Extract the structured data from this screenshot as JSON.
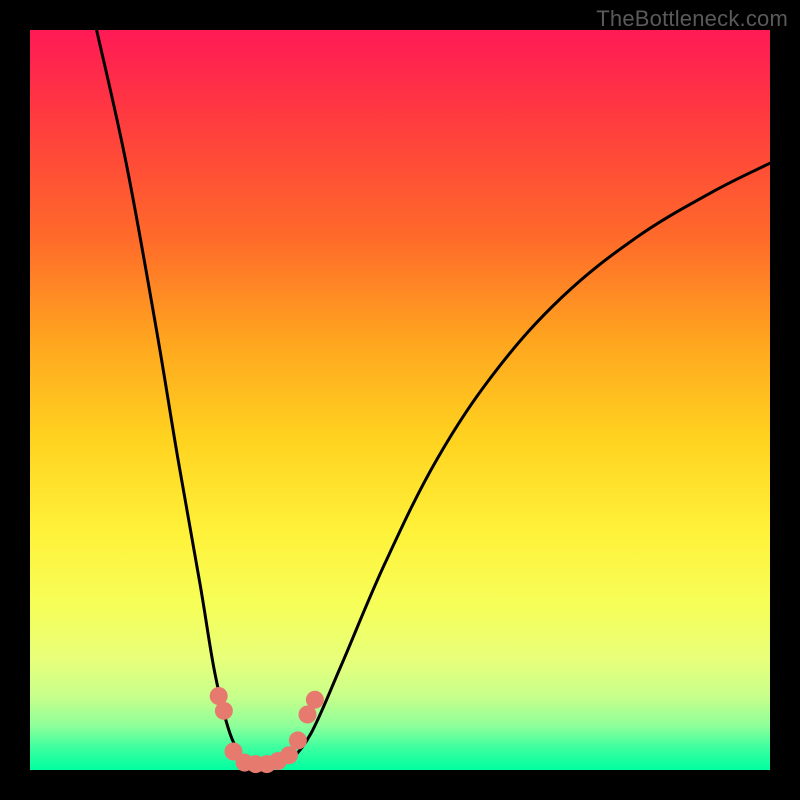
{
  "watermark": "TheBottleneck.com",
  "chart_data": {
    "type": "line",
    "title": "",
    "xlabel": "",
    "ylabel": "",
    "xlim": [
      0,
      100
    ],
    "ylim": [
      0,
      100
    ],
    "grid": false,
    "legend": false,
    "curves": {
      "left_branch": {
        "description": "Steep descending curve from upper-left down to the valley",
        "points": [
          {
            "x": 9,
            "y": 100
          },
          {
            "x": 13,
            "y": 82
          },
          {
            "x": 17,
            "y": 60
          },
          {
            "x": 20,
            "y": 42
          },
          {
            "x": 23,
            "y": 25
          },
          {
            "x": 25,
            "y": 13
          },
          {
            "x": 27,
            "y": 5
          },
          {
            "x": 29,
            "y": 1
          }
        ]
      },
      "right_branch": {
        "description": "Rising curve from valley up toward upper-right",
        "points": [
          {
            "x": 35,
            "y": 1
          },
          {
            "x": 38,
            "y": 5
          },
          {
            "x": 42,
            "y": 14
          },
          {
            "x": 48,
            "y": 28
          },
          {
            "x": 55,
            "y": 42
          },
          {
            "x": 63,
            "y": 54
          },
          {
            "x": 72,
            "y": 64
          },
          {
            "x": 82,
            "y": 72
          },
          {
            "x": 92,
            "y": 78
          },
          {
            "x": 100,
            "y": 82
          }
        ]
      }
    },
    "markers": {
      "description": "Salmon-colored dots near the bottom of the valley in the green band",
      "color": "#e67a6f",
      "points": [
        {
          "x": 25.5,
          "y": 10
        },
        {
          "x": 26.2,
          "y": 8
        },
        {
          "x": 27.5,
          "y": 2.5
        },
        {
          "x": 29.0,
          "y": 1.0
        },
        {
          "x": 30.5,
          "y": 0.8
        },
        {
          "x": 32.0,
          "y": 0.8
        },
        {
          "x": 33.5,
          "y": 1.2
        },
        {
          "x": 35.0,
          "y": 2.0
        },
        {
          "x": 36.2,
          "y": 4.0
        },
        {
          "x": 37.5,
          "y": 7.5
        },
        {
          "x": 38.5,
          "y": 9.5
        }
      ]
    }
  }
}
